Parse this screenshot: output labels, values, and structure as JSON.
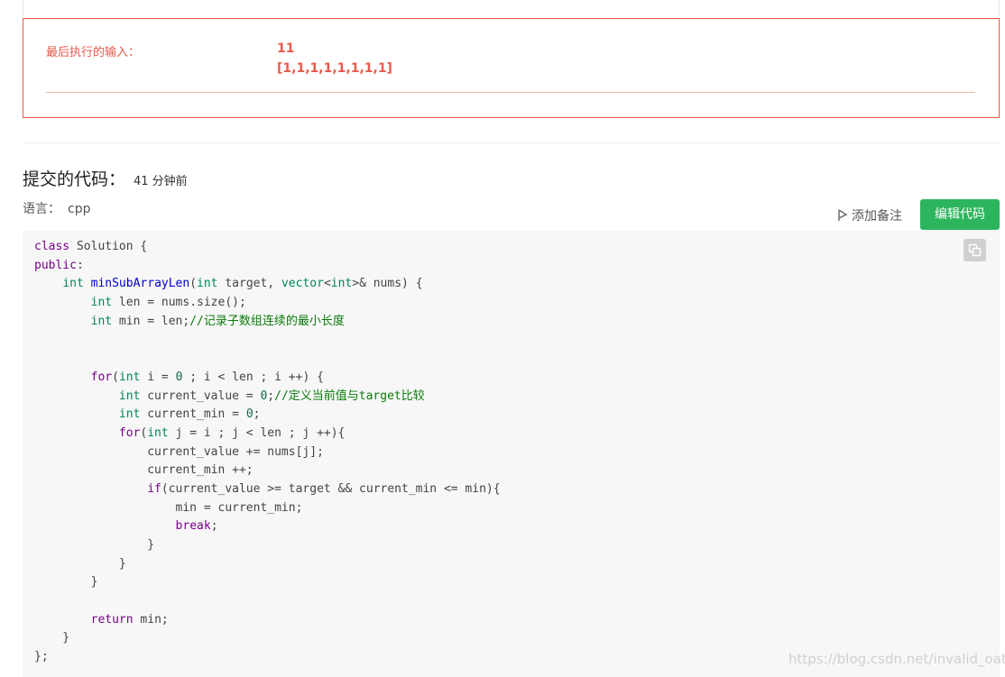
{
  "error": {
    "label": "最后执行的输入：",
    "values": [
      "11",
      "[1,1,1,1,1,1,1,1]"
    ]
  },
  "submission": {
    "heading": "提交的代码：",
    "time": "41 分钟前",
    "language_label": "语言：",
    "language_value": "cpp",
    "add_note_label": "添加备注",
    "edit_button_label": "编辑代码"
  },
  "code_lines": [
    "class Solution {",
    "public:",
    "    int minSubArrayLen(int target, vector<int>& nums) {",
    "        int len = nums.size();",
    "        int min = len;//记录子数组连续的最小长度",
    "",
    "",
    "        for(int i = 0 ; i < len ; i ++) {",
    "            int current_value = 0;//定义当前值与target比较",
    "            int current_min = 0;",
    "            for(int j = i ; j < len ; j ++){",
    "                current_value += nums[j];",
    "                current_min ++;",
    "                if(current_value >= target && current_min <= min){",
    "                    min = current_min;",
    "                    break;",
    "                }",
    "            }",
    "        }",
    "",
    "        return min;",
    "    }",
    "};"
  ],
  "watermark": "https://blog.csdn.net/invalid_oath",
  "colors": {
    "error": "#e8594b",
    "accent_button": "#2db55d",
    "code_background": "#f7f7f7"
  },
  "icons": [
    "flag-icon",
    "copy-icon"
  ]
}
